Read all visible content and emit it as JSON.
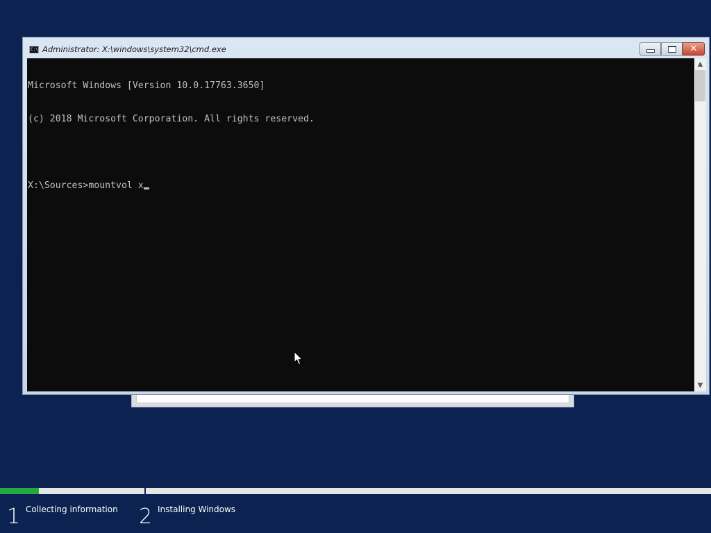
{
  "window": {
    "title": "Administrator: X:\\windows\\system32\\cmd.exe",
    "icon": "cmd-icon",
    "icon_text": "C:\\",
    "buttons": {
      "minimize": "minimize-icon",
      "maximize": "maximize-icon",
      "close": "close-icon",
      "close_glyph": "✕"
    }
  },
  "console": {
    "lines": [
      "Microsoft Windows [Version 10.0.17763.3650]",
      "(c) 2018 Microsoft Corporation. All rights reserved.",
      "",
      "X:\\Sources>mountvol x"
    ],
    "cursor": "_"
  },
  "scrollbar": {
    "up_glyph": "▲",
    "down_glyph": "▼"
  },
  "setup": {
    "progress_fraction": 0.055,
    "accent_color": "#26a843",
    "background_color": "#0c2250",
    "steps": [
      {
        "number": "1",
        "label": "Collecting information"
      },
      {
        "number": "2",
        "label": "Installing Windows"
      }
    ]
  },
  "pointer": "mouse-pointer-icon"
}
